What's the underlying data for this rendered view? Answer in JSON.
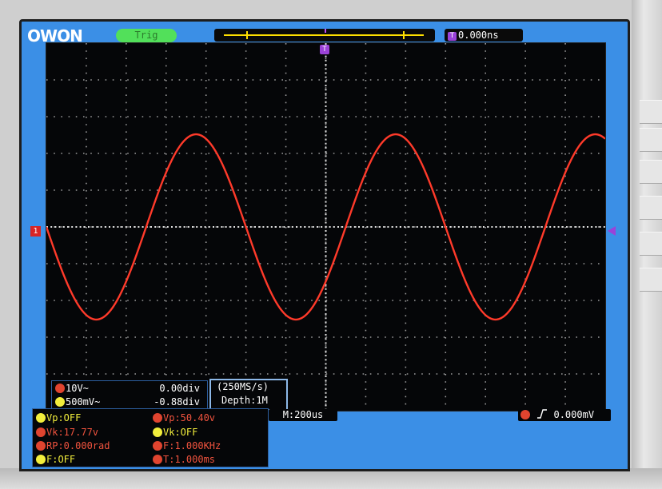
{
  "header": {
    "logo_text": "OWON",
    "trigger_status": "Trig",
    "trigger_marker": "T",
    "time_offset": "0.000ns"
  },
  "channel1": {
    "marker": "1",
    "scale": "10V~",
    "position": "0.00div",
    "color": "#e0442f"
  },
  "channel2": {
    "scale": "500mV~",
    "position": "-0.88div",
    "color": "#f2ee3c"
  },
  "acquisition": {
    "sample_rate": "(250MS/s)",
    "depth": "Depth:1M"
  },
  "measurements": {
    "vp_ch2": "Vp:OFF",
    "vk_ch1": "Vk:17.77v",
    "rp_ch1": "RP:0.000rad",
    "f_ch2": "F:OFF",
    "vp_ch1": "Vp:50.40v",
    "vk_ch2": "Vk:OFF",
    "f_ch1": "F:1.000KHz",
    "t_ch1": "T:1.000ms"
  },
  "timebase": "M:200us",
  "trigger": {
    "level": "0.000mV",
    "edge": "rising"
  },
  "colors": {
    "screen_bg": "#3b8fe6",
    "grid_bg": "#050608",
    "trace_ch1": "#ff3a2a",
    "trigger_badge": "#52e05a",
    "trigger_marker": "#9b42d8"
  },
  "chart_data": {
    "type": "line",
    "x_unit": "us",
    "y_unit": "V",
    "x_divisions": 14,
    "y_divisions": 10,
    "time_per_div_us": 200,
    "volts_per_div": 10,
    "series": [
      {
        "waveform": "sine",
        "frequency_hz": 1000,
        "period_us": 1000,
        "peak_to_peak_v": 50.4,
        "amplitude_v": 25.2,
        "offset_v": 0,
        "start_phase": "descending through 0 V at left edge",
        "x_range_us": [
          0,
          2800
        ]
      }
    ]
  }
}
